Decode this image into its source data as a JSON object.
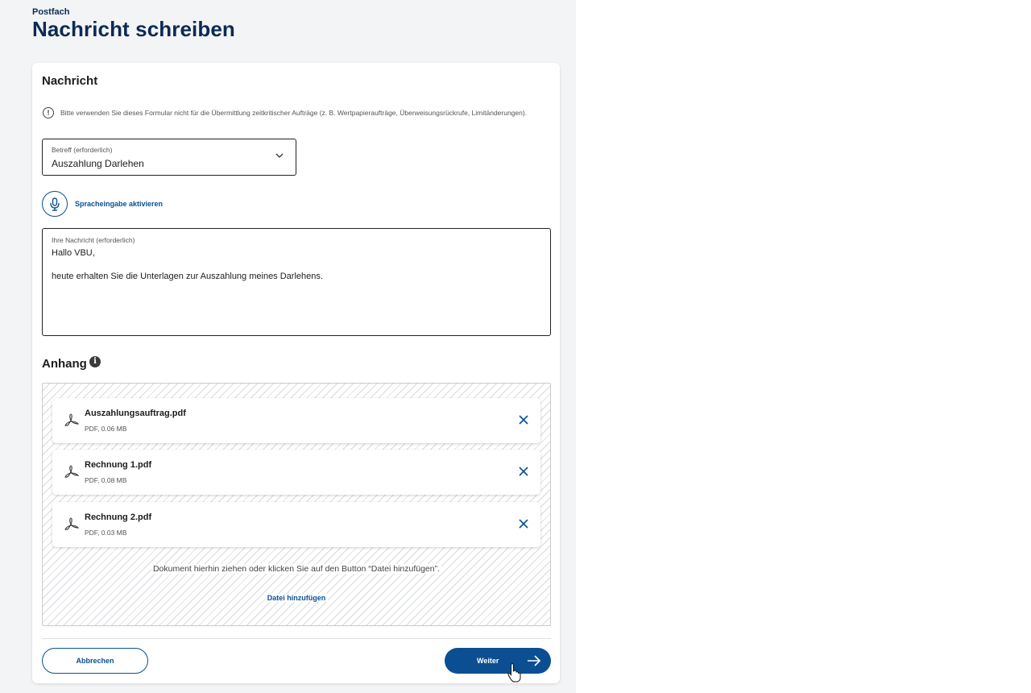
{
  "header": {
    "breadcrumb": "Postfach",
    "title": "Nachricht schreiben"
  },
  "form": {
    "section_title": "Nachricht",
    "notice": "Bitte verwenden Sie dieses Formular nicht für die Übermittlung zeitkritischer Aufträge (z. B. Wertpapieraufträge, Überweisungsrückrufe, Limitänderungen).",
    "subject": {
      "label": "Betreff (erforderlich)",
      "value": "Auszahlung Darlehen"
    },
    "voice_input_label": "Spracheingabe aktivieren",
    "message": {
      "label": "Ihre Nachricht (erforderlich)",
      "line1": "Hallo VBU,",
      "line2": "heute erhalten Sie die Unterlagen zur Auszahlung meines Darlehens."
    }
  },
  "attachments": {
    "title": "Anhang",
    "files": [
      {
        "name": "Auszahlungsauftrag.pdf",
        "meta": "PDF, 0.06 MB"
      },
      {
        "name": "Rechnung 1.pdf",
        "meta": "PDF, 0.08 MB"
      },
      {
        "name": "Rechnung 2.pdf",
        "meta": "PDF, 0.03 MB"
      }
    ],
    "drop_hint": "Dokument hierhin ziehen oder klicken Sie auf den Button “Datei hinzufügen”.",
    "add_file_label": "Datei hinzufügen"
  },
  "actions": {
    "cancel_label": "Abbrechen",
    "next_label": "Weiter"
  },
  "colors": {
    "primary": "#0b4f92",
    "title": "#0b2a55",
    "page_background": "#f3f4f5"
  },
  "icons": [
    "info-circle-icon",
    "chevron-down-icon",
    "microphone-icon",
    "info-icon",
    "pdf-icon",
    "close-icon",
    "arrow-right-icon",
    "hand-cursor-icon"
  ]
}
